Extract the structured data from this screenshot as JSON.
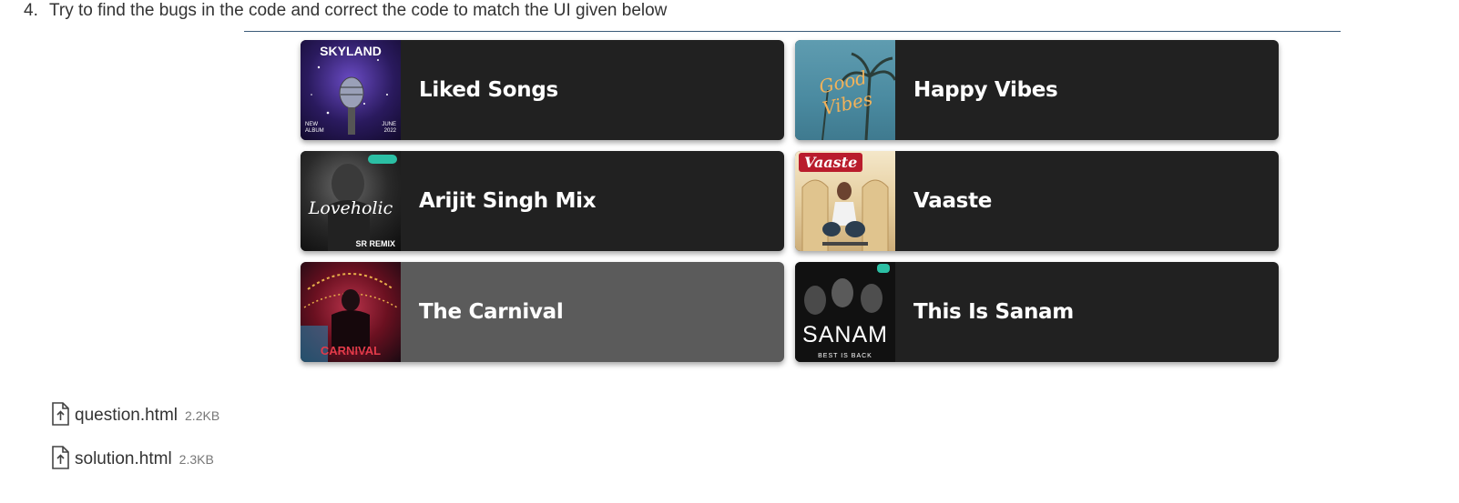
{
  "question": {
    "number": "4.",
    "text": "Try to find the bugs in the code and correct the code to match the UI given below"
  },
  "playlists": [
    {
      "title": "Liked Songs",
      "cover": {
        "top": "SKYLAND",
        "left": "NEW ALBUM",
        "right": "JUNE 2022"
      }
    },
    {
      "title": "Happy Vibes",
      "cover": {
        "text": "Good Vibes"
      }
    },
    {
      "title": "Arijit Singh Mix",
      "cover": {
        "text": "Loveholic",
        "sub": "SR REMIX"
      }
    },
    {
      "title": "Vaaste",
      "cover": {
        "text": "Vaaste"
      }
    },
    {
      "title": "The Carnival",
      "cover": {
        "text": "CARNIVAL"
      }
    },
    {
      "title": "This Is Sanam",
      "cover": {
        "text": "SANAM",
        "sub": "BEST IS BACK"
      }
    }
  ],
  "hovered_card": "The Carnival",
  "attachments": [
    {
      "name": "question.html",
      "size": "2.2KB"
    },
    {
      "name": "solution.html",
      "size": "2.3KB"
    }
  ],
  "colors": {
    "card_bg": "#212121",
    "card_hover_bg": "#5b5b5b",
    "title": "#ffffff"
  }
}
